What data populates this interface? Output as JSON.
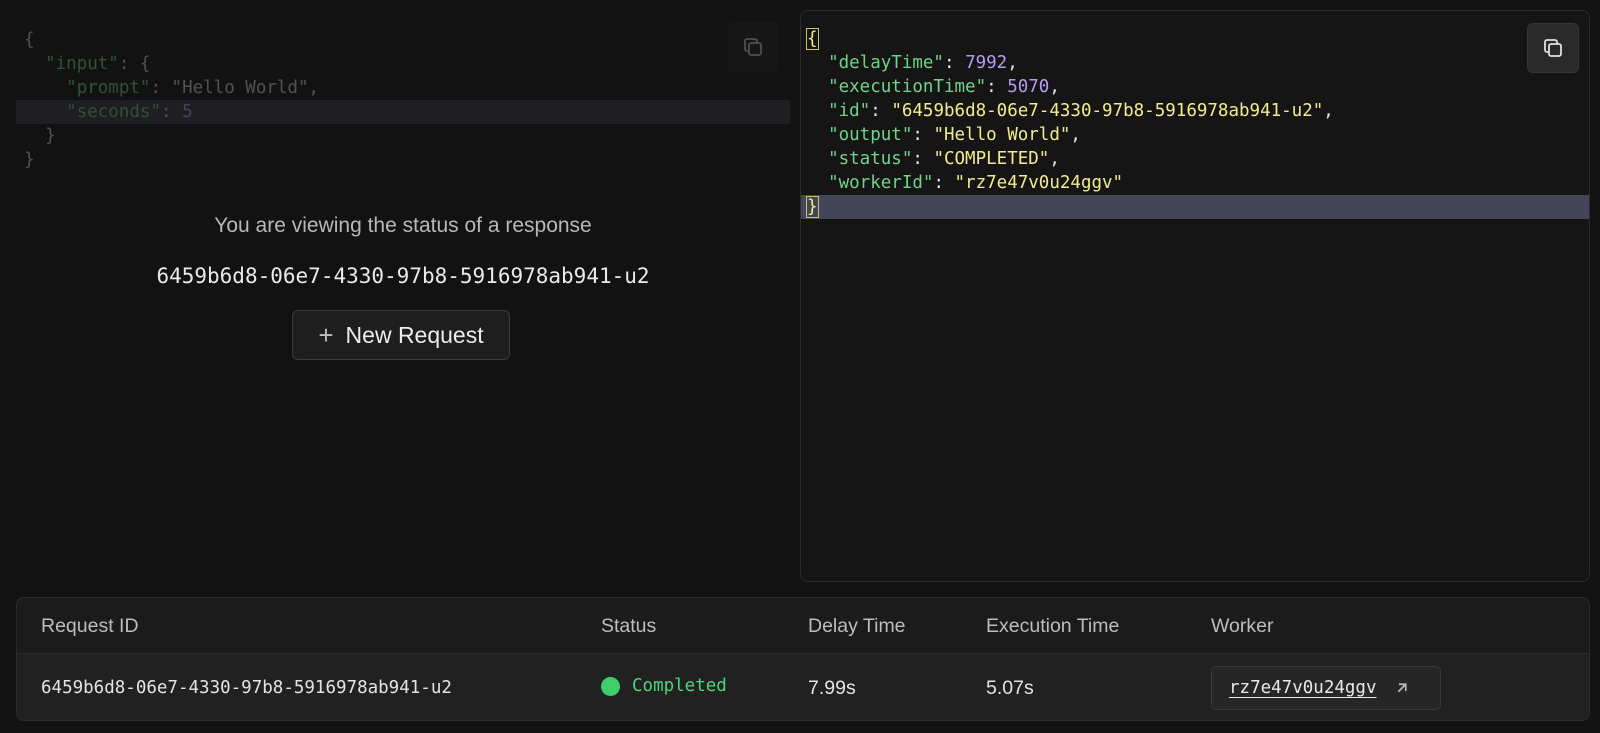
{
  "request_json": {
    "lines": [
      {
        "indent": "",
        "key": "",
        "sep": "{",
        "value": "",
        "value_type": "",
        "tail": ""
      },
      {
        "indent": "  ",
        "key": "\"input\"",
        "sep": ": {",
        "value": "",
        "value_type": "",
        "tail": ""
      },
      {
        "indent": "    ",
        "key": "\"prompt\"",
        "sep": ": ",
        "value": "\"Hello World\"",
        "value_type": "string",
        "tail": ","
      },
      {
        "indent": "    ",
        "key": "\"seconds\"",
        "sep": ": ",
        "value": "5",
        "value_type": "number",
        "tail": ""
      },
      {
        "indent": "  ",
        "key": "",
        "sep": "}",
        "value": "",
        "value_type": "",
        "tail": ""
      },
      {
        "indent": "",
        "key": "",
        "sep": "}",
        "value": "",
        "value_type": "",
        "tail": ""
      }
    ]
  },
  "status_panel": {
    "message": "You are viewing the status of a response",
    "request_id": "6459b6d8-06e7-4330-97b8-5916978ab941-u2",
    "new_request_label": "New Request"
  },
  "response_json": {
    "open": "{",
    "close": "}",
    "fields": [
      {
        "key": "\"delayTime\"",
        "value": "7992",
        "value_type": "number",
        "tail": ","
      },
      {
        "key": "\"executionTime\"",
        "value": "5070",
        "value_type": "number",
        "tail": ","
      },
      {
        "key": "\"id\"",
        "value": "\"6459b6d8-06e7-4330-97b8-5916978ab941-u2\"",
        "value_type": "string",
        "tail": ","
      },
      {
        "key": "\"output\"",
        "value": "\"Hello World\"",
        "value_type": "string",
        "tail": ","
      },
      {
        "key": "\"status\"",
        "value": "\"COMPLETED\"",
        "value_type": "string",
        "tail": ","
      },
      {
        "key": "\"workerId\"",
        "value": "\"rz7e47v0u24ggv\"",
        "value_type": "string",
        "tail": ""
      }
    ]
  },
  "table": {
    "headers": {
      "request_id": "Request ID",
      "status": "Status",
      "delay_time": "Delay Time",
      "execution_time": "Execution Time",
      "worker": "Worker"
    },
    "row": {
      "request_id": "6459b6d8-06e7-4330-97b8-5916978ab941-u2",
      "status": "Completed",
      "delay_time": "7.99s",
      "execution_time": "5.07s",
      "worker": "rz7e47v0u24ggv"
    }
  },
  "colors": {
    "background": "#121212",
    "json_key": "#6fd48a",
    "json_string": "#f2ec8f",
    "json_number": "#b39df3",
    "status_completed": "#3fcf6a"
  },
  "icons": {
    "copy": "copy-icon",
    "plus": "plus-icon",
    "external_link": "arrow-up-right-icon",
    "status_dot": "status-dot-icon"
  }
}
